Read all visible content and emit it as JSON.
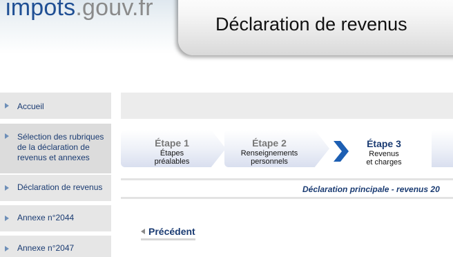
{
  "header": {
    "logo_part1": "impots",
    "logo_part2": ".gouv.fr",
    "title": "Déclaration de revenus"
  },
  "sidebar": {
    "items": [
      {
        "label": "Accueil"
      },
      {
        "label_lines": [
          "Sélection des rubriques",
          "de la déclaration de",
          "revenus et annexes"
        ]
      },
      {
        "label": "Déclaration de revenus"
      },
      {
        "label": "Annexe n°2044"
      },
      {
        "label": "Annexe n°2047"
      }
    ]
  },
  "steps": [
    {
      "name": "Étape 1",
      "desc_lines": [
        "Étapes",
        "préalables"
      ]
    },
    {
      "name": "Étape 2",
      "desc_lines": [
        "Renseignements",
        "personnels"
      ]
    },
    {
      "name": "Étape 3",
      "desc_lines": [
        "Revenus",
        "et charges"
      ]
    }
  ],
  "colors": {
    "link_blue": "#1a3b72",
    "sidebar_bg": "#e6e6e6",
    "chevron_blue": "#1d5fb3"
  },
  "declaration_title": "Déclaration principale - revenus 20",
  "previous_label": "Précédent"
}
